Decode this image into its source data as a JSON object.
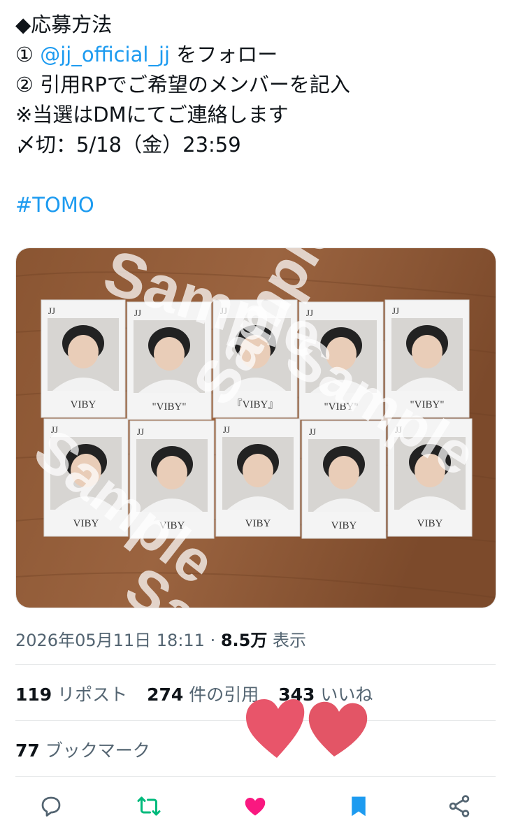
{
  "tweet": {
    "heading": "◆応募方法",
    "step1_prefix": "① ",
    "step1_mention": "@jj_official_jj",
    "step1_suffix": " をフォロー",
    "step2": "② 引用RPでご希望のメンバーを記入",
    "note": "※当選はDMにてご連絡します",
    "deadline": "〆切：5/18（金）23:59",
    "hashtag": "#TOMO"
  },
  "media": {
    "watermark": "Sample",
    "cards": [
      {
        "header": "JJ",
        "footer": "VIBY"
      },
      {
        "header": "JJ",
        "footer": "\"VIBY\""
      },
      {
        "header": "JJ",
        "footer": "『VIBY』"
      },
      {
        "header": "JJ",
        "footer": "\"VIBY\""
      },
      {
        "header": "JJ",
        "footer": "\"VIBY\""
      },
      {
        "header": "JJ",
        "footer": "VIBY"
      },
      {
        "header": "JJ",
        "footer": "VIBY"
      },
      {
        "header": "JJ",
        "footer": "VIBY"
      },
      {
        "header": "JJ",
        "footer": "VIBY"
      },
      {
        "header": "JJ",
        "footer": "VIBY"
      }
    ]
  },
  "meta": {
    "datetime": "2026年05月11日 18:11",
    "separator": " · ",
    "views_count": "8.5万",
    "views_label": " 表示"
  },
  "stats": {
    "reposts_count": "119",
    "reposts_label": " リポスト",
    "quotes_count": "274",
    "quotes_label": " 件の引用",
    "likes_count": "343",
    "likes_label": " いいね",
    "bookmarks_count": "77",
    "bookmarks_label": " ブックマーク"
  },
  "actions": [
    {
      "icon": "reply-icon",
      "color": "#536471"
    },
    {
      "icon": "repost-icon",
      "color": "#00ba7c"
    },
    {
      "icon": "like-icon",
      "color": "#f91880"
    },
    {
      "icon": "bookmark-icon",
      "color": "#1d9bf0"
    },
    {
      "icon": "share-icon",
      "color": "#536471"
    }
  ],
  "colors": {
    "link": "#1d9bf0",
    "secondary_text": "#536471",
    "heart_sticker": "#e8556a"
  }
}
